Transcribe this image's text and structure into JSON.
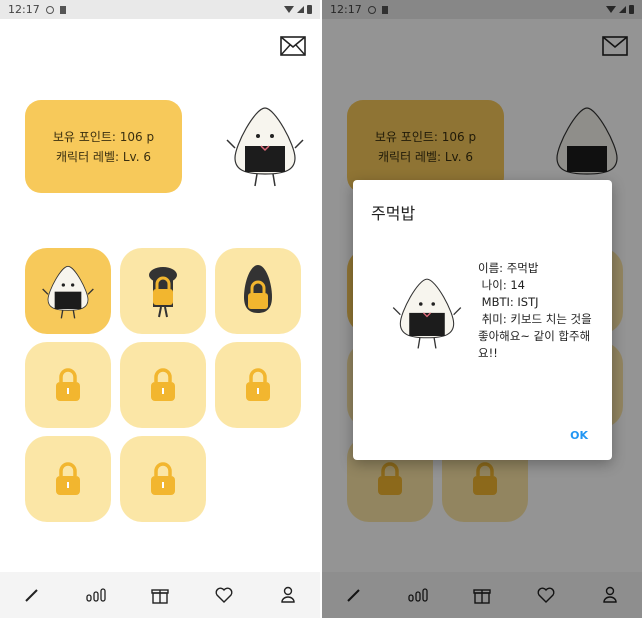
{
  "status": {
    "time": "12:17"
  },
  "home": {
    "points_text": "보유 포인트: 106 p",
    "level_text": "캐릭터 레벨: Lv. 6"
  },
  "dialog": {
    "title": "주먹밥",
    "name_line": "이름: 주먹밥",
    "age_line": " 나이: 14",
    "mbti_line": " MBTI: ISTJ",
    "hobby_line": " 취미: 키보드 치는 것을 좋아해요~ 같이 합주해요!!",
    "ok_label": "OK"
  },
  "nav": [
    "pencil-icon",
    "chart-icon",
    "gift-icon",
    "heart-icon",
    "person-icon"
  ],
  "colors": {
    "accent": "#f7c95a",
    "tile": "#fbe6a6",
    "lock": "#f2b62f",
    "link": "#2196f3"
  }
}
